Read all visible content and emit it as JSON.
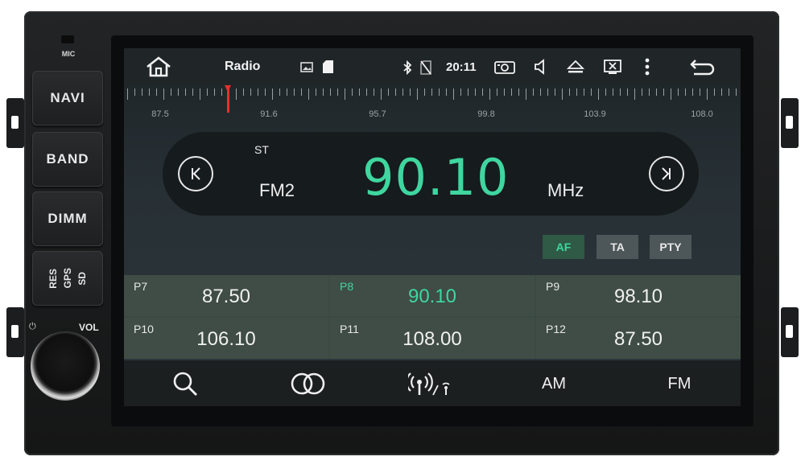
{
  "hardware": {
    "mic_label": "MIC",
    "buttons": [
      "NAVI",
      "BAND",
      "DIMM"
    ],
    "sgr_labels": [
      "RES",
      "GPS",
      "SD"
    ],
    "vol_label": "VOL"
  },
  "statusbar": {
    "title": "Radio",
    "time": "20:11",
    "icons": [
      "home-icon",
      "gallery-icon",
      "sd-card-icon",
      "bluetooth-icon",
      "no-sim-icon",
      "camera-icon",
      "volume-icon",
      "eject-icon",
      "close-window-icon",
      "more-vert-icon",
      "back-icon"
    ]
  },
  "tuner": {
    "labels": [
      "87.5",
      "91.6",
      "95.7",
      "99.8",
      "103.9",
      "108.0"
    ]
  },
  "radio": {
    "stereo": "ST",
    "band": "FM2",
    "frequency": "90.10",
    "unit": "MHz"
  },
  "options": {
    "af": "AF",
    "ta": "TA",
    "pty": "PTY"
  },
  "presets": [
    {
      "name": "P7",
      "freq": "87.50"
    },
    {
      "name": "P8",
      "freq": "90.10"
    },
    {
      "name": "P9",
      "freq": "98.10"
    },
    {
      "name": "P10",
      "freq": "106.10"
    },
    {
      "name": "P11",
      "freq": "108.00"
    },
    {
      "name": "P12",
      "freq": "87.50"
    }
  ],
  "bottombar": {
    "am": "AM",
    "fm": "FM"
  },
  "colors": {
    "accent": "#3fd6a0",
    "needle": "#e8302c",
    "preset_bg": "#3f4d46"
  }
}
